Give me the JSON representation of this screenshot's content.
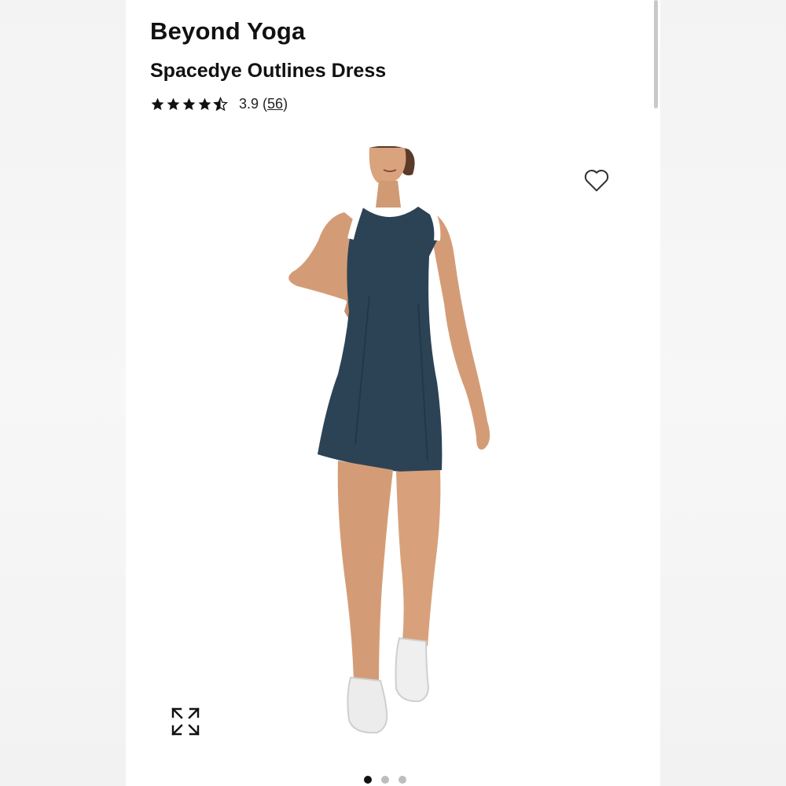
{
  "product": {
    "brand": "Beyond Yoga",
    "name": "Spacedye Outlines Dress",
    "rating": {
      "value": "3.9",
      "count_open": "(",
      "count": "56",
      "count_close": ")",
      "stars_fraction": 0.78
    }
  },
  "gallery": {
    "image_icon": "product-photo",
    "current_index": 1,
    "total": 3
  },
  "icons": {
    "favorite": "heart-icon",
    "expand": "expand-icon"
  },
  "colors": {
    "dress": "#2c4356",
    "trim": "#ffffff",
    "text": "#111111",
    "dot_inactive": "#bdbdbd",
    "dot_active": "#111111"
  }
}
